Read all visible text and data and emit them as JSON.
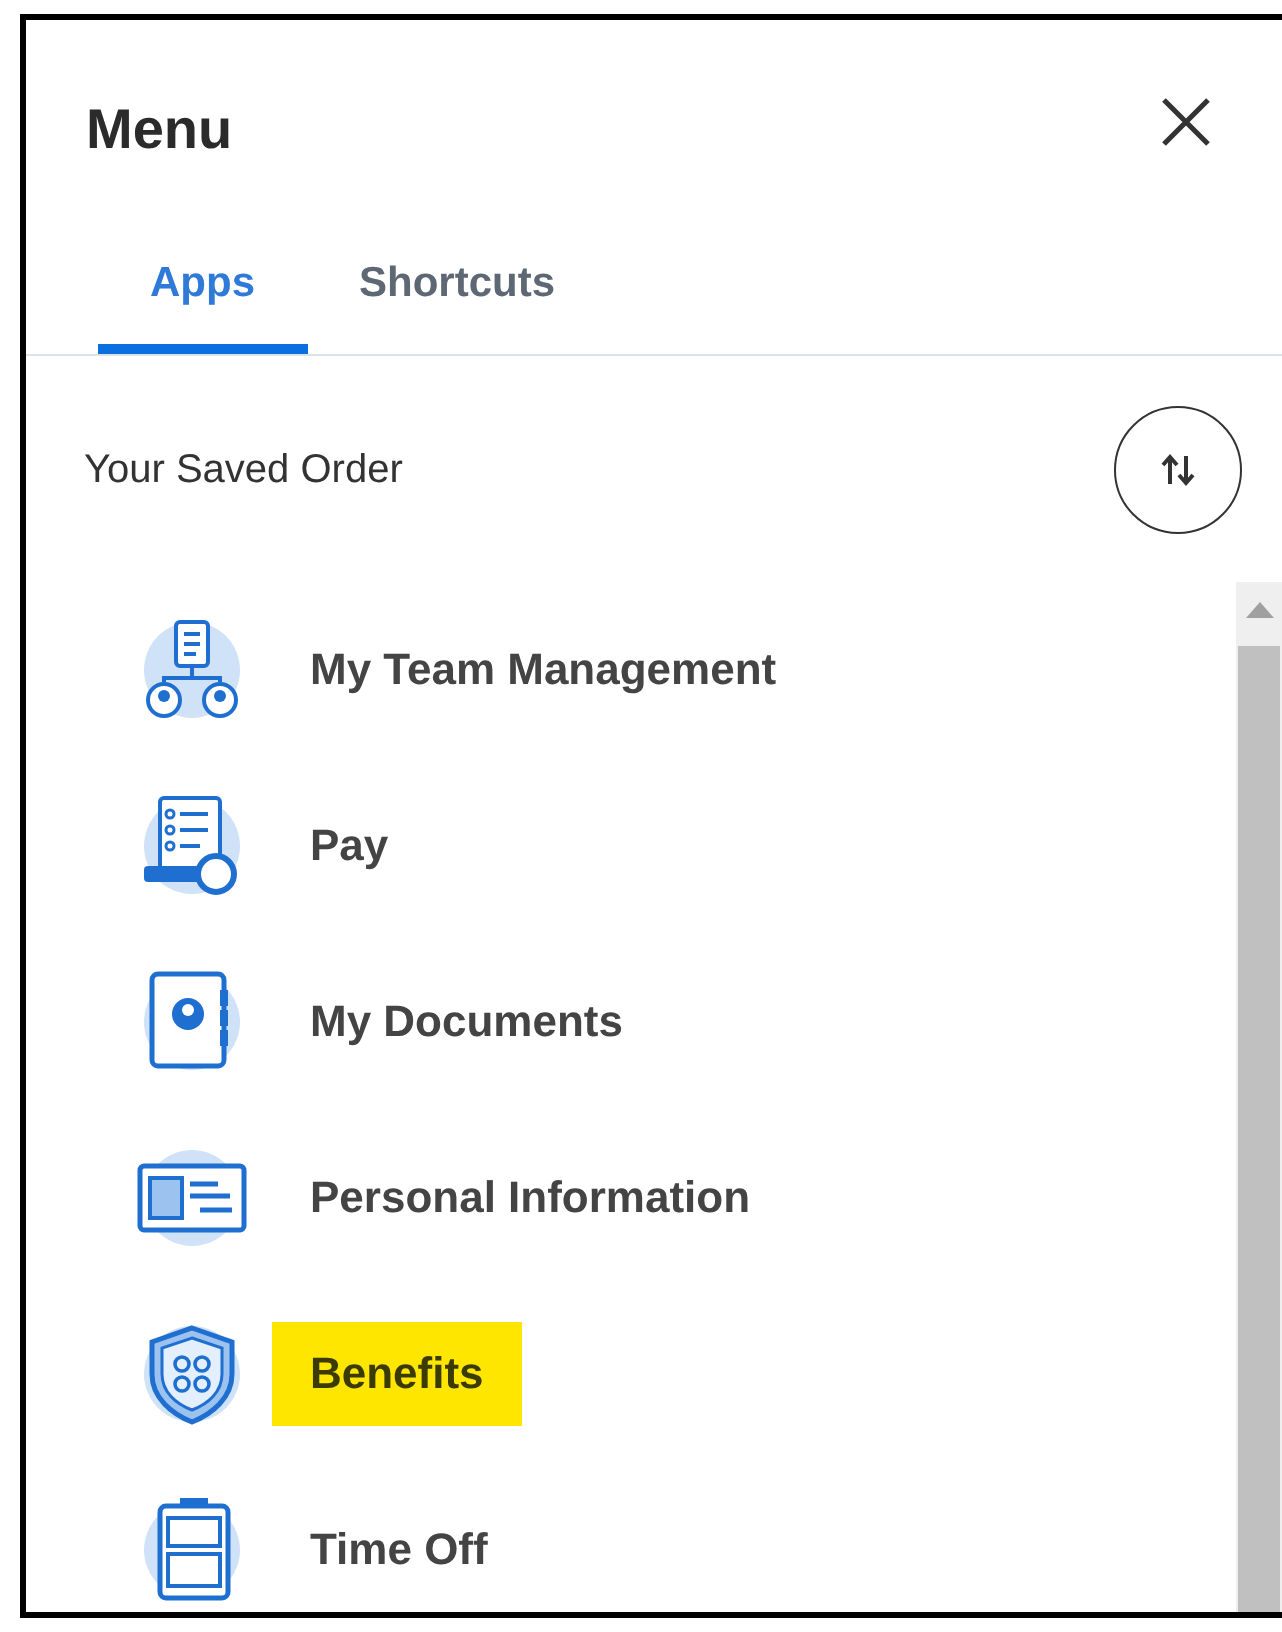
{
  "header": {
    "title": "Menu"
  },
  "tabs": [
    {
      "label": "Apps",
      "selected": true
    },
    {
      "label": "Shortcuts",
      "selected": false
    }
  ],
  "section": {
    "title": "Your Saved Order"
  },
  "items": [
    {
      "label": "My Team Management",
      "kind": "team",
      "highlighted": false
    },
    {
      "label": "Pay",
      "kind": "pay",
      "highlighted": false
    },
    {
      "label": "My Documents",
      "kind": "documents",
      "highlighted": false
    },
    {
      "label": "Personal Information",
      "kind": "personal",
      "highlighted": false
    },
    {
      "label": "Benefits",
      "kind": "benefits",
      "highlighted": true
    },
    {
      "label": "Time Off",
      "kind": "timeoff",
      "highlighted": false
    }
  ]
}
